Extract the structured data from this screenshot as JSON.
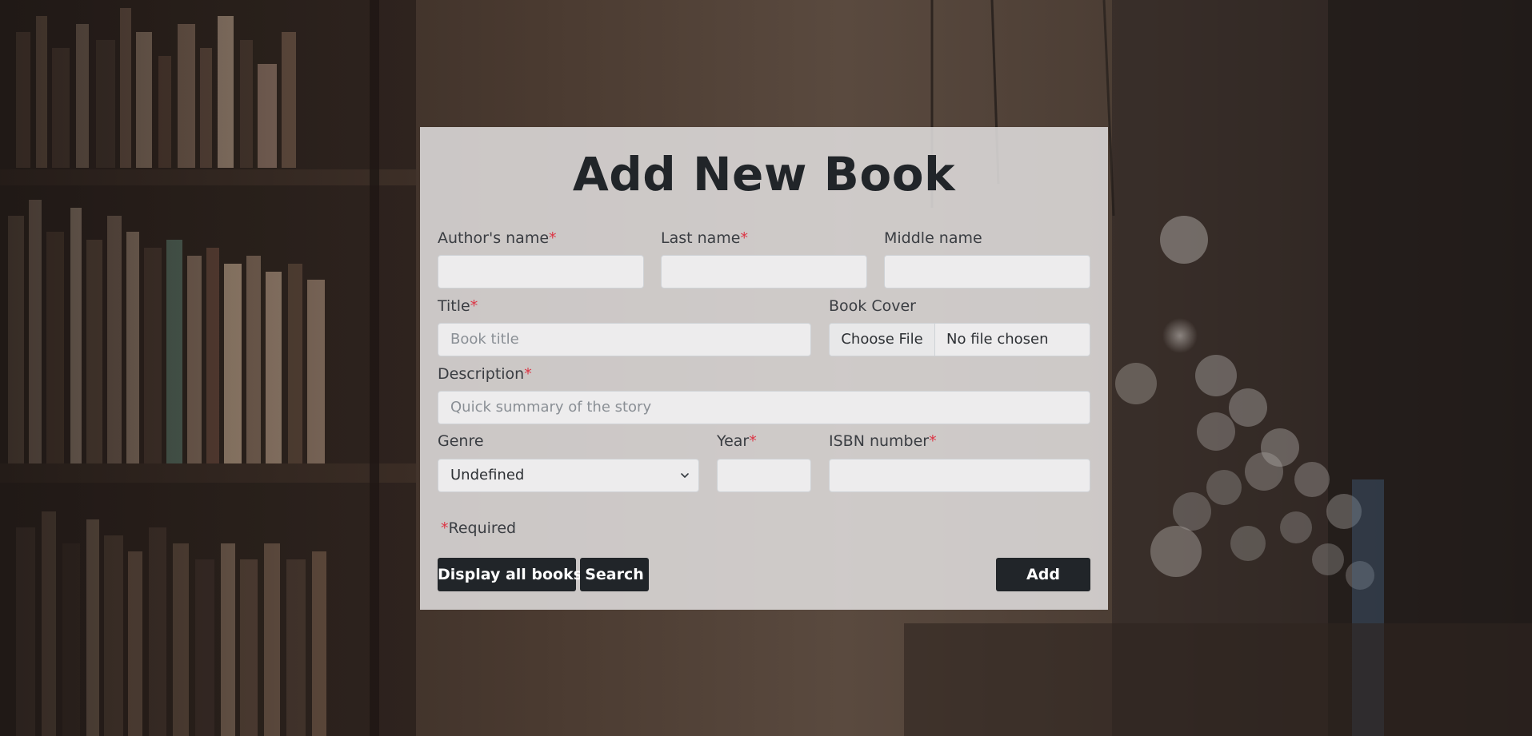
{
  "page": {
    "title": "Add New Book"
  },
  "form": {
    "author_first_label": "Author's name",
    "author_last_label": "Last name",
    "middle_label": "Middle name",
    "title_label": "Title",
    "title_placeholder": "Book title",
    "cover_label": "Book Cover",
    "cover_button": "Choose File",
    "cover_status": "No file chosen",
    "description_label": "Description",
    "description_placeholder": "Quick summary of the story",
    "genre_label": "Genre",
    "genre_value": "Undefined",
    "year_label": "Year",
    "isbn_label": "ISBN number",
    "required_marker": "*",
    "required_note": "Required"
  },
  "buttons": {
    "display_all": "Display all books",
    "search": "Search",
    "add": "Add"
  },
  "icons": {
    "genre_dropdown": "chevron-down-icon"
  },
  "colors": {
    "required": "#dc3545",
    "button_bg": "#212529",
    "panel_bg": "#e2dfe0"
  }
}
